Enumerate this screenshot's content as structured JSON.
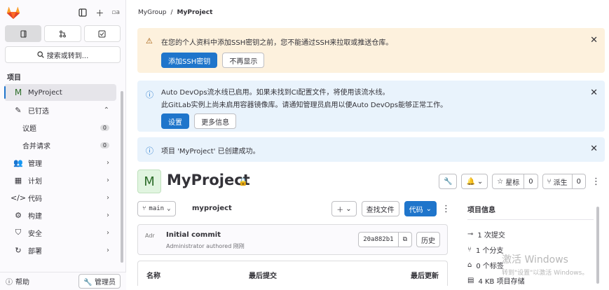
{
  "sidebar": {
    "search_label": "搜索或转到...",
    "section_title": "项目",
    "items": [
      {
        "label": "MyProject",
        "icon": "M"
      },
      {
        "label": "已钉选",
        "icon": "pin"
      },
      {
        "label": "议题",
        "count": "0"
      },
      {
        "label": "合并请求",
        "count": "0"
      },
      {
        "label": "管理",
        "icon": "users"
      },
      {
        "label": "计划",
        "icon": "calendar"
      },
      {
        "label": "代码",
        "icon": "code"
      },
      {
        "label": "构建",
        "icon": "rocket"
      },
      {
        "label": "安全",
        "icon": "shield"
      },
      {
        "label": "部署",
        "icon": "deploy"
      }
    ],
    "help_label": "帮助",
    "admin_label": "管理员"
  },
  "breadcrumb": {
    "group": "MyGroup",
    "sep": "/",
    "project": "MyProject"
  },
  "alerts": {
    "ssh": {
      "text": "在您的个人资料中添加SSH密钥之前，您不能通过SSH来拉取或推送仓库。",
      "primary": "添加SSH密钥",
      "secondary": "不再显示"
    },
    "devops": {
      "line1": "Auto DevOps流水线已启用。如果未找到CI配置文件，将使用该流水线。",
      "line2": "此GitLab实例上尚未启用容器镜像库。请通知管理员启用以便Auto DevOps能够正常工作。",
      "primary": "设置",
      "secondary": "更多信息"
    },
    "created": {
      "text": "项目 'MyProject' 已创建成功。"
    }
  },
  "project": {
    "avatar_letter": "M",
    "title": "MyProject",
    "star_label": "星标",
    "star_count": "0",
    "fork_label": "派生",
    "fork_count": "0"
  },
  "repo": {
    "branch": "main",
    "name": "myproject",
    "find_file": "查找文件",
    "code_button": "代码"
  },
  "commit": {
    "avatar_alt": "Adr",
    "title": "Initial commit",
    "subtitle": "Administrator authored 刚刚",
    "sha": "20a882b1",
    "history": "历史"
  },
  "table": {
    "col_name": "名称",
    "col_last_commit": "最后提交",
    "col_last_update": "最后更新"
  },
  "project_info": {
    "title": "项目信息",
    "commits": "1 次提交",
    "branches": "1 个分支",
    "tags": "0 个标签",
    "storage": "4 KB 项目存储"
  },
  "watermark": {
    "line1": "激活 Windows",
    "line2": "转到\"设置\"以激活 Windows。"
  },
  "colors": {
    "primary": "#1f75cb",
    "warning_bg": "#fdf1dd",
    "info_bg": "#e9f3fc"
  }
}
